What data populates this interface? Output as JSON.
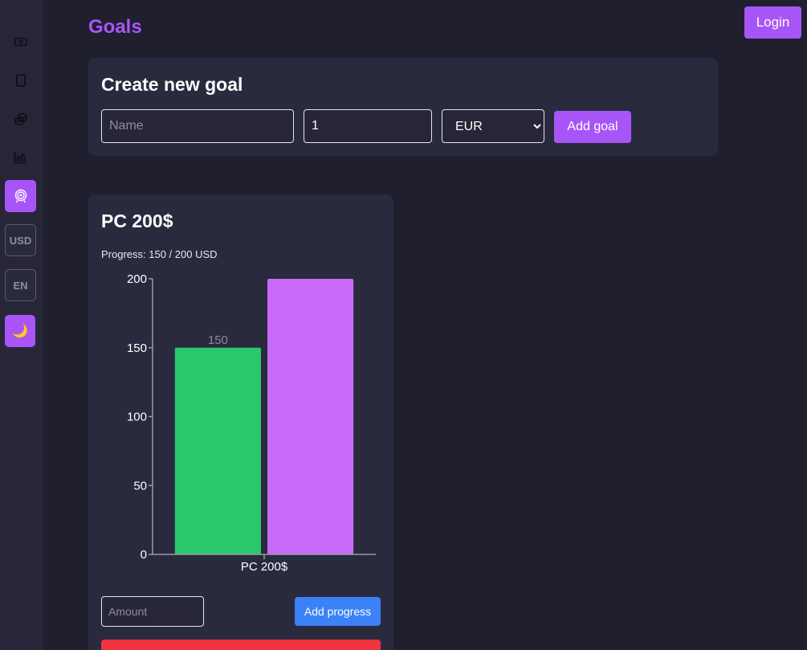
{
  "page": {
    "title": "Goals"
  },
  "header": {
    "login_label": "Login"
  },
  "sidebar": {
    "items": [
      {
        "icon": "wallet-icon"
      },
      {
        "icon": "book-icon"
      },
      {
        "icon": "coins-icon"
      },
      {
        "icon": "chart-icon"
      },
      {
        "icon": "target-icon",
        "active": true
      },
      {
        "label": "USD"
      },
      {
        "label": "EN"
      },
      {
        "icon": "moon-icon",
        "glyph": "🌙"
      }
    ]
  },
  "create_goal": {
    "title": "Create new goal",
    "name_placeholder": "Name",
    "amount_value": "1",
    "currency_value": "EUR",
    "currency_options": [
      "EUR"
    ],
    "add_label": "Add goal"
  },
  "goals": [
    {
      "title": "PC 200$",
      "progress_text": "Progress: 150 / 200 USD",
      "amount_placeholder": "Amount",
      "add_progress_label": "Add progress"
    }
  ],
  "colors": {
    "accent": "#a855f7",
    "progress_bar": "#2bc86b",
    "target_bar": "#c86afa",
    "button_blue": "#3b82f6",
    "danger": "#ef3340"
  },
  "chart_data": {
    "type": "bar",
    "categories": [
      "PC 200$"
    ],
    "series": [
      {
        "values": [
          150
        ],
        "color": "#2bc86b",
        "data_label": "150"
      },
      {
        "values": [
          200
        ],
        "color": "#c86afa"
      }
    ],
    "ylim": [
      0,
      200
    ],
    "yticks": [
      0,
      50,
      100,
      150,
      200
    ],
    "xlabel": "",
    "ylabel": "",
    "grid": false
  }
}
